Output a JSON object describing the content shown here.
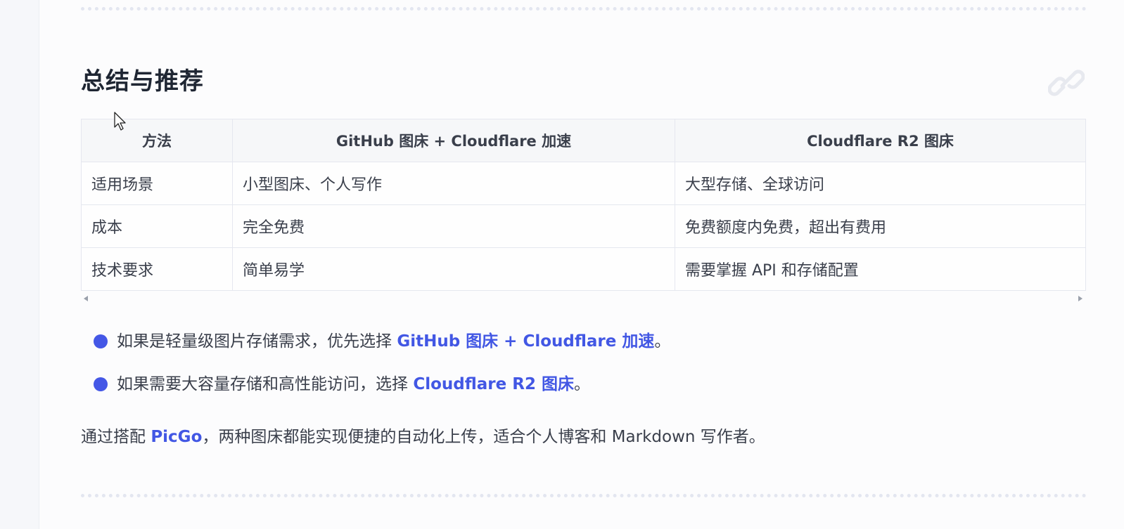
{
  "section": {
    "title": "总结与推荐"
  },
  "table": {
    "headers": [
      "方法",
      "GitHub 图床 + Cloudflare 加速",
      "Cloudflare R2 图床"
    ],
    "rows": [
      [
        "适用场景",
        "小型图床、个人写作",
        "大型存储、全球访问"
      ],
      [
        "成本",
        "完全免费",
        "免费额度内免费，超出有费用"
      ],
      [
        "技术要求",
        "简单易学",
        "需要掌握 API 和存储配置"
      ]
    ]
  },
  "bullets": [
    {
      "prefix": "如果是轻量级图片存储需求，优先选择 ",
      "link": "GitHub 图床 + Cloudflare 加速",
      "suffix": "。"
    },
    {
      "prefix": "如果需要大容量存储和高性能访问，选择 ",
      "link": "Cloudflare R2 图床",
      "suffix": "。"
    }
  ],
  "summary": {
    "prefix": "通过搭配 ",
    "link": "PicGo",
    "suffix": "，两种图床都能实现便捷的自动化上传，适合个人博客和 Markdown 写作者。"
  },
  "colors": {
    "accent": "#4257e4",
    "heading": "#1f2633",
    "text": "#3a3f4b",
    "header_bg": "#f6f7f9"
  },
  "icons": [
    "link-icon",
    "cursor-arrow-icon",
    "scroll-left-arrow-icon",
    "scroll-right-arrow-icon",
    "bullet-dot-icon"
  ]
}
